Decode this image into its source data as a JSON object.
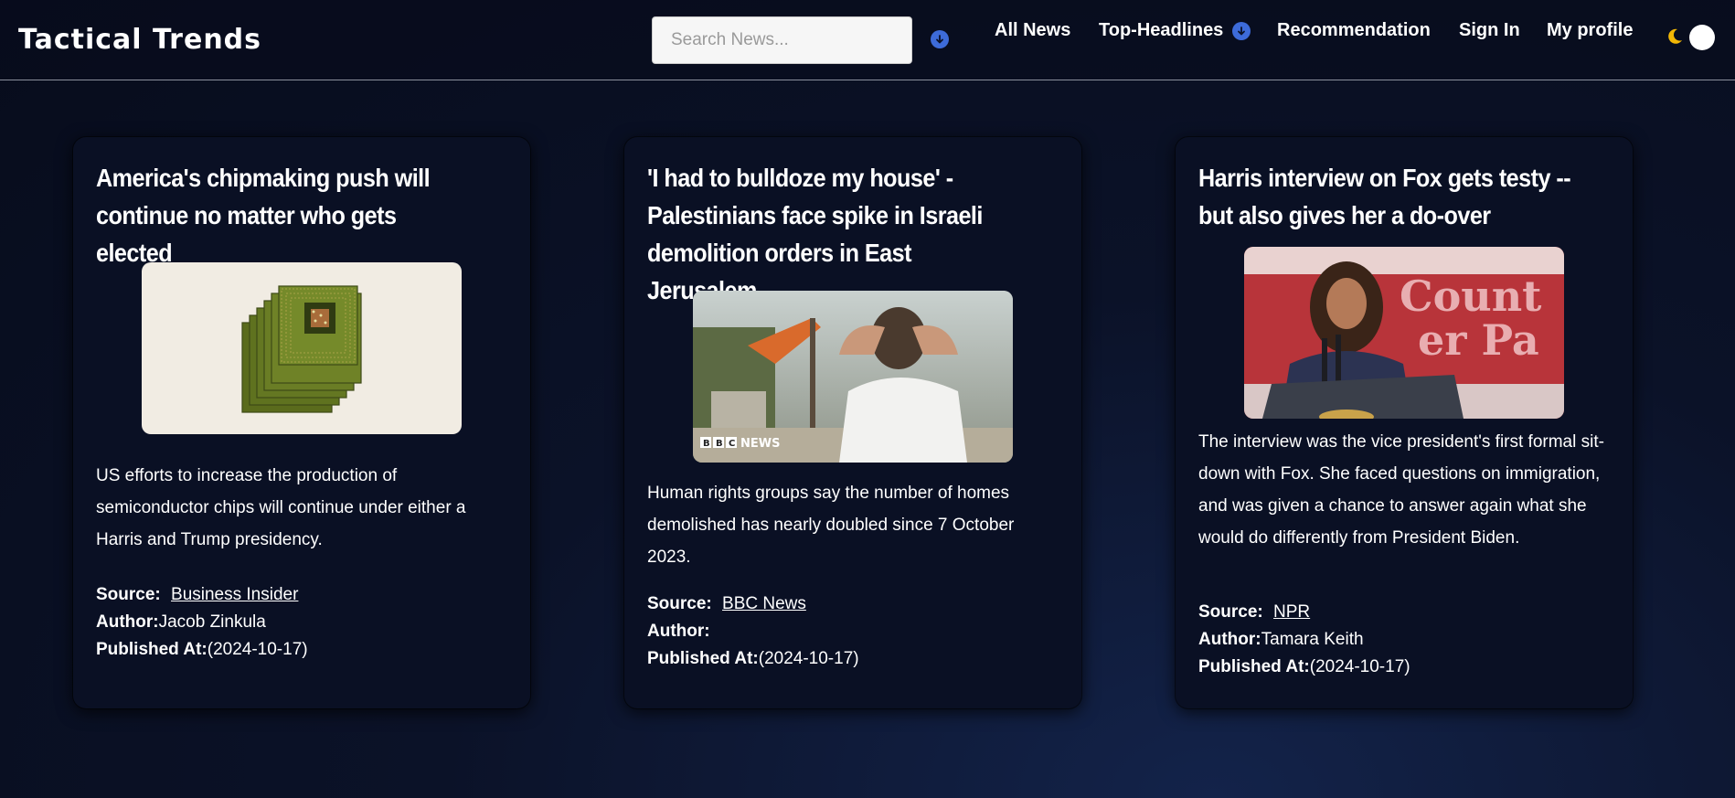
{
  "navbar": {
    "brand": "Tactical Trends",
    "search_placeholder": "Search News...",
    "links": [
      "All News",
      "Top-Headlines",
      "Recommendation",
      "Sign In",
      "My profile"
    ]
  },
  "colors": {
    "accent": "#3d6bd9",
    "moon": "#f2b705",
    "card_bg": "#0a1024"
  },
  "icons": {
    "download": "arrow-down-circle-icon",
    "theme": "moon-icon"
  },
  "articles": [
    {
      "title": "America's chipmaking push will continue no matter who gets elected",
      "image": "semiconductor chips illustration",
      "description": "US efforts to increase the production of semiconductor chips will continue under either a Harris and Trump presidency.",
      "source_label": "Source:",
      "source": "Business Insider",
      "author_label": "Author:",
      "author": "Jacob Zinkula",
      "published_label": "Published At:",
      "published": "(2024-10-17)"
    },
    {
      "title": "'I had to bulldoze my house' - Palestinians face spike in Israeli demolition orders in East Jerusalem",
      "image": "man with hands on head watching demolition",
      "image_watermark": "BBC NEWS",
      "description": "Human rights groups say the number of homes demolished has nearly doubled since 7 October 2023.",
      "source_label": "Source:",
      "source": "BBC News",
      "author_label": "Author:",
      "author": "",
      "published_label": "Published At:",
      "published": "(2024-10-17)"
    },
    {
      "title": "Harris interview on Fox gets testy -- but also gives her a do-over",
      "image": "Harris at podium",
      "image_sign_text": "Count er Pa",
      "description": "The interview was the vice president's first formal sit-down with Fox. She faced questions on immigration, and was given a chance to answer again what she would do differently from President Biden.",
      "source_label": "Source:",
      "source": "NPR",
      "author_label": "Author:",
      "author": "Tamara Keith",
      "published_label": "Published At:",
      "published": "(2024-10-17)"
    }
  ]
}
